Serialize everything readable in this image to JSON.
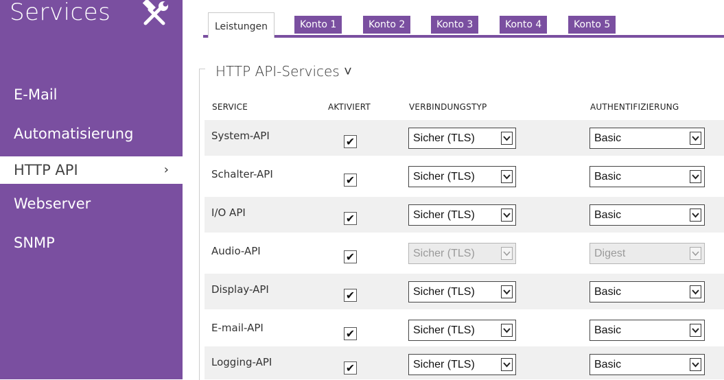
{
  "sidebar": {
    "title": "Services",
    "icon": "tools-icon",
    "items": [
      {
        "label": "E-Mail",
        "active": false
      },
      {
        "label": "Automatisierung",
        "active": false
      },
      {
        "label": "HTTP API",
        "active": true
      },
      {
        "label": "Webserver",
        "active": false
      },
      {
        "label": "SNMP",
        "active": false
      }
    ],
    "active_chevron": "›"
  },
  "tabs": [
    {
      "label": "Leistungen",
      "active": true
    },
    {
      "label": "Konto 1",
      "active": false
    },
    {
      "label": "Konto 2",
      "active": false
    },
    {
      "label": "Konto 3",
      "active": false
    },
    {
      "label": "Konto 4",
      "active": false
    },
    {
      "label": "Konto 5",
      "active": false
    }
  ],
  "section": {
    "title": "HTTP API-Services ˅"
  },
  "table": {
    "headers": {
      "service": "SERVICE",
      "enabled": "AKTIVIERT",
      "connection": "VERBINDUNGSTYP",
      "auth": "AUTHENTIFIZIERUNG"
    },
    "rows": [
      {
        "service": "System-API",
        "enabled": true,
        "connection": "Sicher (TLS)",
        "auth": "Basic",
        "disabled": false
      },
      {
        "service": "Schalter-API",
        "enabled": true,
        "connection": "Sicher (TLS)",
        "auth": "Basic",
        "disabled": false
      },
      {
        "service": "I/O API",
        "enabled": true,
        "connection": "Sicher (TLS)",
        "auth": "Basic",
        "disabled": false
      },
      {
        "service": "Audio-API",
        "enabled": true,
        "connection": "Sicher (TLS)",
        "auth": "Digest",
        "disabled": true
      },
      {
        "service": "Display-API",
        "enabled": true,
        "connection": "Sicher (TLS)",
        "auth": "Basic",
        "disabled": false
      },
      {
        "service": "E-mail-API",
        "enabled": true,
        "connection": "Sicher (TLS)",
        "auth": "Basic",
        "disabled": false
      },
      {
        "service": "Logging-API",
        "enabled": true,
        "connection": "Sicher (TLS)",
        "auth": "Basic",
        "disabled": false
      }
    ],
    "check_glyph": "✔"
  },
  "colors": {
    "accent": "#7a4fa0",
    "row_shade": "#f0f0f0"
  }
}
